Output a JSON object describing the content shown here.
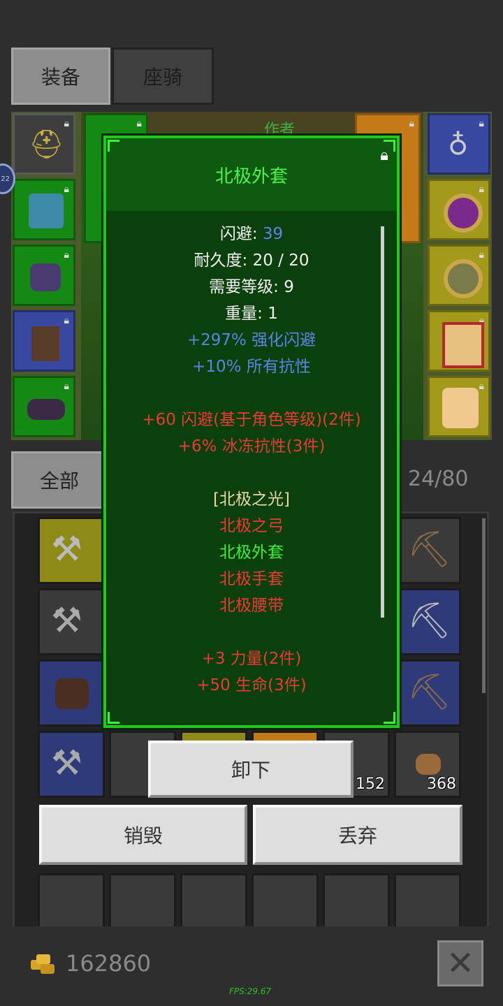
{
  "tabs": {
    "equip": "装备",
    "mount": "座骑"
  },
  "author_label": "作者",
  "level_badge": "22",
  "filter": {
    "all": "全部",
    "capacity": "24/80"
  },
  "popup": {
    "title": "北极外套",
    "stats": [
      {
        "label": "闪避: ",
        "value": "39"
      },
      {
        "text": "耐久度: 20 / 20"
      },
      {
        "text": "需要等级: 9"
      },
      {
        "text": "重量: 1"
      },
      {
        "text": "+297% 强化闪避"
      },
      {
        "text": "+10% 所有抗性"
      }
    ],
    "set_bonus": [
      "+60 闪避(基于角色等级)(2件)",
      "+6% 冰冻抗性(3件)"
    ],
    "set_name": "[北极之光]",
    "set_items": [
      "北极之弓",
      "北极外套",
      "北极手套",
      "北极腰带"
    ],
    "set_bonus2": [
      "+3 力量(2件)",
      "+50 生命(3件)"
    ]
  },
  "buttons": {
    "unequip": "卸下",
    "destroy": "销毁",
    "drop": "丢弃"
  },
  "item_counts": {
    "a": "152",
    "b": "368"
  },
  "gold": "162860",
  "fps": "FPS:29.67",
  "icons": [
    "helmet-icon",
    "chest-armor-icon",
    "gloves-icon",
    "boots-icon",
    "belt-icon",
    "amulet-icon",
    "ring-purple-icon",
    "ring-gold-icon",
    "book-icon",
    "portrait-icon",
    "axe-icon",
    "pickaxe-icon",
    "gold-coins-icon",
    "close-icon",
    "lock-icon"
  ]
}
